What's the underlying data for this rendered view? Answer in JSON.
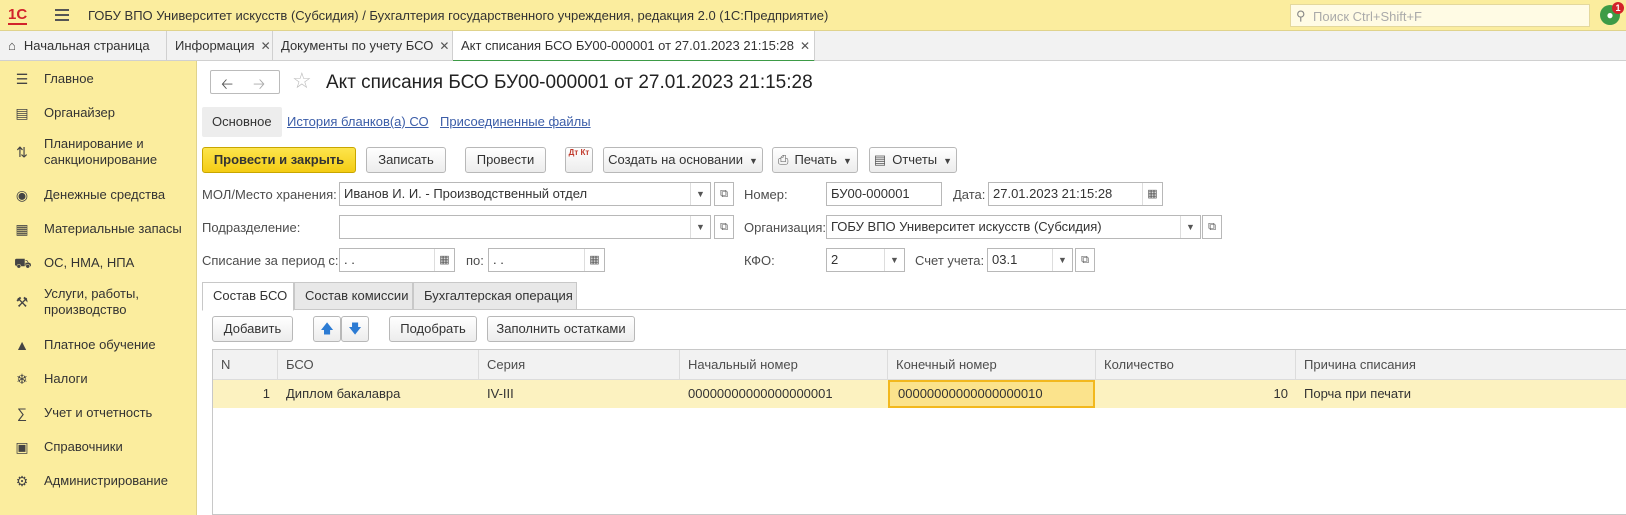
{
  "app": {
    "title": "ГОБУ ВПО Университет искусств (Субсидия) / Бухгалтерия государственного учреждения, редакция 2.0  (1С:Предприятие)",
    "search_placeholder": "Поиск Ctrl+Shift+F",
    "notifications_count": "1",
    "colors": {
      "accent": "#fbed9e",
      "primary_button": "#f4cc14",
      "active_tab": "#3d9b46",
      "link": "#3b5da8"
    }
  },
  "window_tabs": [
    {
      "label": "Начальная страница"
    },
    {
      "label": "Информация"
    },
    {
      "label": "Документы по учету БСО"
    },
    {
      "label": "Акт списания БСО БУ00-000001 от 27.01.2023 21:15:28"
    }
  ],
  "sidebar": {
    "items": [
      {
        "label": "Главное",
        "icon": "menu-lines-icon"
      },
      {
        "label": "Органайзер",
        "icon": "clipboard-icon"
      },
      {
        "label": "Планирование и санкционирование",
        "icon": "planning-icon"
      },
      {
        "label": "Денежные средства",
        "icon": "coin-icon"
      },
      {
        "label": "Материальные запасы",
        "icon": "grid-icon"
      },
      {
        "label": "ОС, НМА, НПА",
        "icon": "truck-icon"
      },
      {
        "label": "Услуги, работы, производство",
        "icon": "tools-icon"
      },
      {
        "label": "Платное обучение",
        "icon": "graduation-cap-icon"
      },
      {
        "label": "Налоги",
        "icon": "emblem-icon"
      },
      {
        "label": "Учет и отчетность",
        "icon": "accounting-icon"
      },
      {
        "label": "Справочники",
        "icon": "book-icon"
      },
      {
        "label": "Администрирование",
        "icon": "gear-icon"
      }
    ]
  },
  "document": {
    "title": "Акт списания БСО БУ00-000001 от 27.01.2023 21:15:28",
    "sections": {
      "main": "Основное",
      "history": "История бланков(а) СО",
      "files": "Присоединенные файлы"
    },
    "toolbar": {
      "post_close": "Провести и закрыть",
      "save": "Записать",
      "post": "Провести",
      "dt_kt": "Дт Кт",
      "create_based": "Создать на основании",
      "print": "Печать",
      "reports": "Отчеты"
    },
    "fields": {
      "mol_label": "МОЛ/Место хранения:",
      "mol_value": "Иванов И. И. - Производственный отдел",
      "number_label": "Номер:",
      "number_value": "БУ00-000001",
      "date_label": "Дата:",
      "date_value": "27.01.2023 21:15:28",
      "division_label": "Подразделение:",
      "division_value": "",
      "org_label": "Организация:",
      "org_value": "ГОБУ ВПО Университет искусств (Субсидия)",
      "period_label": "Списание за период с:",
      "period_from": " .  .",
      "period_to_label": "по:",
      "period_to": " .  .",
      "kfo_label": "КФО:",
      "kfo_value": "2",
      "account_label": "Счет учета:",
      "account_value": "03.1"
    },
    "panel_tabs": [
      "Состав БСО",
      "Состав комиссии",
      "Бухгалтерская операция"
    ],
    "table_toolbar": {
      "add": "Добавить",
      "pick": "Подобрать",
      "fill": "Заполнить остатками"
    },
    "table": {
      "columns": [
        "N",
        "БСО",
        "Серия",
        "Начальный номер",
        "Конечный номер",
        "Количество",
        "Причина списания"
      ],
      "rows": [
        [
          "1",
          "Диплом бакалавра",
          "IV-III",
          "00000000000000000001",
          "00000000000000000010",
          "10",
          "Порча при печати"
        ]
      ]
    }
  }
}
